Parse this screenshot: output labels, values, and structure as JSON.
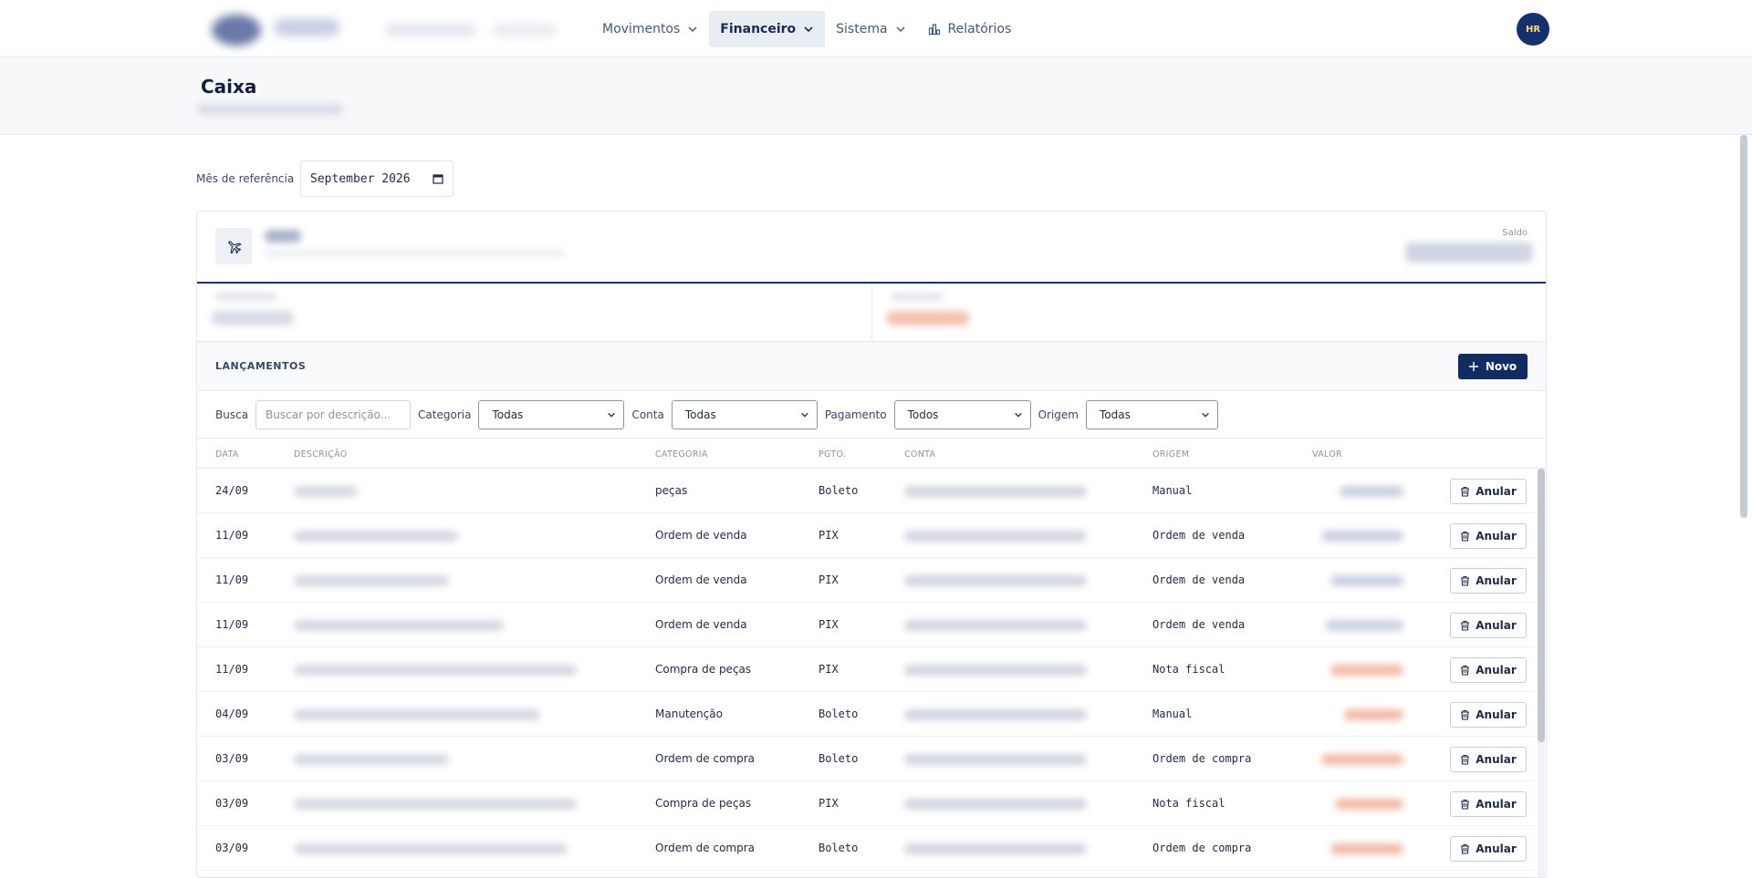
{
  "nav": {
    "items": [
      {
        "label": "Movimentos",
        "has_dropdown": true
      },
      {
        "label": "Financeiro",
        "has_dropdown": true,
        "active": true
      },
      {
        "label": "Sistema",
        "has_dropdown": true
      },
      {
        "label": "Relatórios",
        "icon": "bar-chart-icon"
      }
    ],
    "avatar": "HR"
  },
  "header": {
    "title": "Caixa"
  },
  "filters_top": {
    "ref_label": "Mês de referência",
    "month_value": "September 2026"
  },
  "summary": {
    "saldo_label": "Saldo"
  },
  "lancamentos": {
    "title": "LANÇAMENTOS",
    "novo_label": "Novo",
    "filters": {
      "busca_label": "Busca",
      "busca_placeholder": "Buscar por descrição...",
      "categoria_label": "Categoria",
      "categoria_value": "Todas",
      "conta_label": "Conta",
      "conta_value": "Todas",
      "pagamento_label": "Pagamento",
      "pagamento_value": "Todos",
      "origem_label": "Origem",
      "origem_value": "Todas"
    },
    "columns": [
      "DATA",
      "DESCRIÇÃO",
      "CATEGORIA",
      "PGTO.",
      "CONTA",
      "ORIGEM",
      "VALOR"
    ],
    "action_label": "Anular",
    "rows": [
      {
        "data": "24/09",
        "categoria": "peças",
        "pgto": "Boleto",
        "origem": "Manual",
        "valor_tone": "neutral"
      },
      {
        "data": "11/09",
        "categoria": "Ordem de venda",
        "pgto": "PIX",
        "origem": "Ordem de venda",
        "valor_tone": "neutral"
      },
      {
        "data": "11/09",
        "categoria": "Ordem de venda",
        "pgto": "PIX",
        "origem": "Ordem de venda",
        "valor_tone": "neutral"
      },
      {
        "data": "11/09",
        "categoria": "Ordem de venda",
        "pgto": "PIX",
        "origem": "Ordem de venda",
        "valor_tone": "neutral"
      },
      {
        "data": "11/09",
        "categoria": "Compra de peças",
        "pgto": "PIX",
        "origem": "Nota fiscal",
        "valor_tone": "negative"
      },
      {
        "data": "04/09",
        "categoria": "Manutenção",
        "pgto": "Boleto",
        "origem": "Manual",
        "valor_tone": "negative"
      },
      {
        "data": "03/09",
        "categoria": "Ordem de compra",
        "pgto": "Boleto",
        "origem": "Ordem de compra",
        "valor_tone": "negative"
      },
      {
        "data": "03/09",
        "categoria": "Compra de peças",
        "pgto": "PIX",
        "origem": "Nota fiscal",
        "valor_tone": "negative"
      },
      {
        "data": "03/09",
        "categoria": "Ordem de compra",
        "pgto": "Boleto",
        "origem": "Ordem de compra",
        "valor_tone": "negative"
      }
    ]
  },
  "colors": {
    "primary": "#112c63",
    "negative": "#f3b9a6",
    "neutral": "#c9d0df"
  }
}
